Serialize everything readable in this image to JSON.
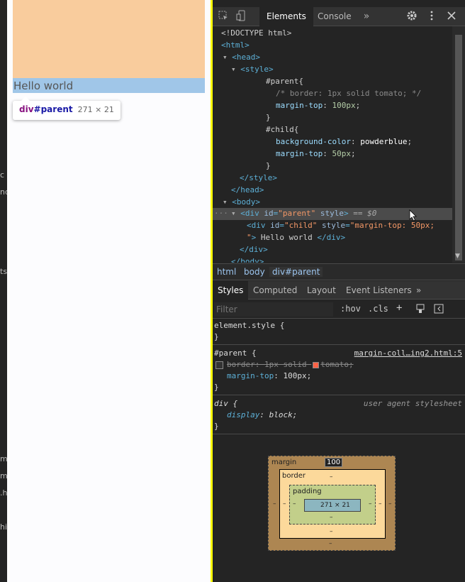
{
  "preview": {
    "hello_text": "Hello world",
    "tooltip": {
      "tag": "div",
      "id": "#parent",
      "size": "271 × 21"
    }
  },
  "devtools": {
    "tabs": [
      "Elements",
      "Console"
    ],
    "more": "»",
    "dom_lines": {
      "l1": "<!DOCTYPE html>",
      "l2": "<html>",
      "l3": "<head>",
      "l4": "<style>",
      "l5": "#parent{",
      "l6": "/* border: 1px solid tomato; */",
      "l7_prop": "margin-top",
      "l7_val": "100px",
      "l8": "}",
      "l9": "#child{",
      "l10_prop": "background-color",
      "l10_val": "powderblue",
      "l11_prop": "margin-top",
      "l11_val": "50px",
      "l12": "}",
      "l13": "</style>",
      "l14": "</head>",
      "l15": "<body>",
      "sel_open": "<div",
      "sel_attr1": "id",
      "sel_val1": "\"parent\"",
      "sel_attr2": "style",
      "sel_close": ">",
      "sel_eq": "== $0",
      "c_open": "<div",
      "c_attr1": "id",
      "c_val1": "\"child\"",
      "c_attr2": "style",
      "c_val2": "\"margin-top: 50px;",
      "c_text": "\"> Hello world ",
      "c_close": "</div>",
      "l19": "</div>",
      "l20": "</body>"
    },
    "breadcrumbs": [
      "html",
      "body",
      "div#parent"
    ],
    "styles_tabs": [
      "Styles",
      "Computed",
      "Layout",
      "Event Listeners"
    ],
    "filter_placeholder": "Filter",
    "filter_buttons": [
      ":hov",
      ".cls",
      "+"
    ],
    "rules": {
      "element_style": "element.style {",
      "element_close": "}",
      "parent_sel": "#parent {",
      "parent_src": "margin-coll…ing2.html:5",
      "border_decl": "border: 1px solid ",
      "border_color": "tomato;",
      "mt_prop": "margin-top",
      "mt_val": "100px;",
      "parent_close": "}",
      "div_sel": "div {",
      "div_src": "user agent stylesheet",
      "display_prop": "display",
      "display_val": "block;",
      "div_close": "}"
    },
    "box_model": {
      "margin_label": "margin",
      "margin_top": "100",
      "border_label": "border",
      "padding_label": "padding",
      "content": "271 × 21",
      "dash": "–"
    }
  },
  "left_strip_glyphs": [
    "c",
    "nd",
    "ts",
    "m",
    "m",
    ".h",
    "hi"
  ]
}
